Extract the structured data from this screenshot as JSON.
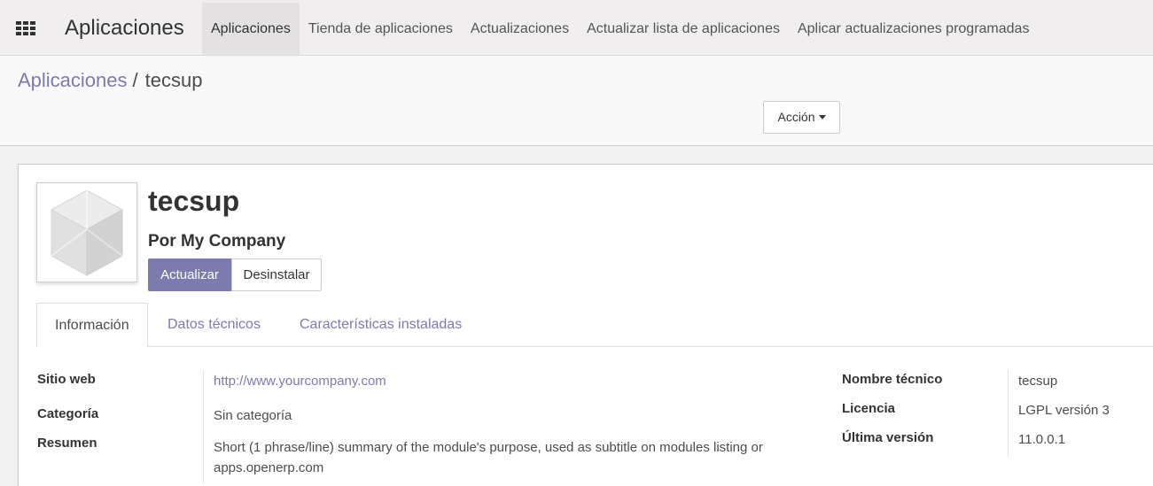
{
  "navbar": {
    "brand": "Aplicaciones",
    "menu": [
      {
        "label": "Aplicaciones",
        "active": true
      },
      {
        "label": "Tienda de aplicaciones"
      },
      {
        "label": "Actualizaciones"
      },
      {
        "label": "Actualizar lista de aplicaciones"
      },
      {
        "label": "Aplicar actualizaciones programadas"
      }
    ]
  },
  "breadcrumb": {
    "parent": "Aplicaciones",
    "separator": "/",
    "current": "tecsup"
  },
  "control": {
    "action_label": "Acción"
  },
  "module": {
    "name": "tecsup",
    "author": "Por My Company",
    "upgrade_label": "Actualizar",
    "uninstall_label": "Desinstalar",
    "image_icon": "module-cube-icon"
  },
  "tabs": [
    {
      "label": "Información",
      "active": true
    },
    {
      "label": "Datos técnicos"
    },
    {
      "label": "Características instaladas"
    }
  ],
  "info": {
    "website_label": "Sitio web",
    "website_value": "http://www.yourcompany.com",
    "category_label": "Categoría",
    "category_value": "Sin categoría",
    "summary_label": "Resumen",
    "summary_value": "Short (1 phrase/line) summary of the module's purpose, used as subtitle on modules listing or apps.openerp.com",
    "technical_name_label": "Nombre técnico",
    "technical_name_value": "tecsup",
    "license_label": "Licencia",
    "license_value": "LGPL versión 3",
    "latest_version_label": "Última versión",
    "latest_version_value": "11.0.0.1"
  },
  "colors": {
    "primary": "#7c7bad",
    "navbar_bg": "#f0eeee",
    "text": "#4c4c4c"
  }
}
